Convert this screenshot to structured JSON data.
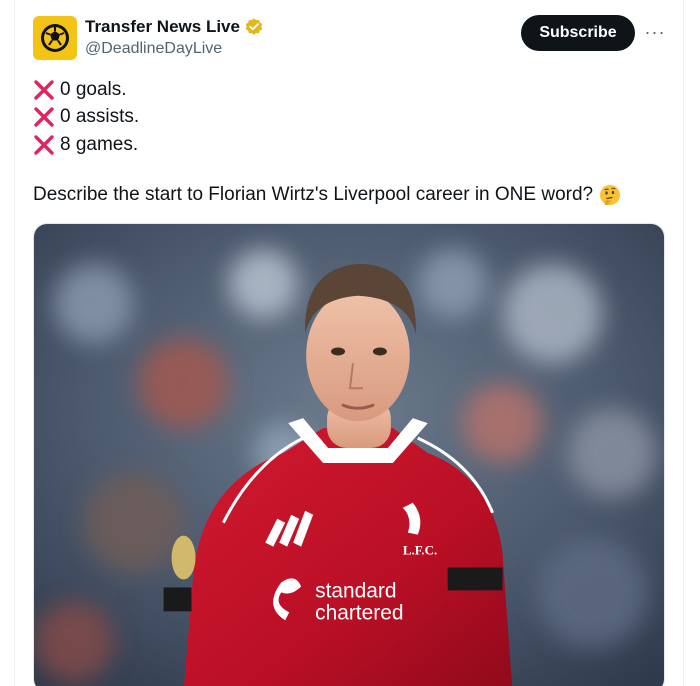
{
  "account": {
    "display_name": "Transfer News Live",
    "handle": "@DeadlineDayLive",
    "avatar_icon": "football-clock-logo",
    "verified_icon": "verified-badge-icon",
    "verified_color": "#e2b719"
  },
  "actions": {
    "subscribe_label": "Subscribe",
    "more_label": "···"
  },
  "tweet": {
    "stats": [
      {
        "icon": "cross-mark-icon",
        "text": "0 goals."
      },
      {
        "icon": "cross-mark-icon",
        "text": "0 assists."
      },
      {
        "icon": "cross-mark-icon",
        "text": "8 games."
      }
    ],
    "question": "Describe the start to Florian Wirtz's Liverpool career in ONE word?",
    "question_emoji": "thinking-face-icon"
  },
  "media": {
    "type": "photo",
    "kit_text_sponsor_1": "standard",
    "kit_text_sponsor_2": "chartered",
    "kit_text_club": "L.F.C.",
    "kit_color": "#c8102e"
  },
  "colors": {
    "cross": "#e0245e",
    "subscribe_bg": "#0f1419",
    "handle": "#536471"
  }
}
